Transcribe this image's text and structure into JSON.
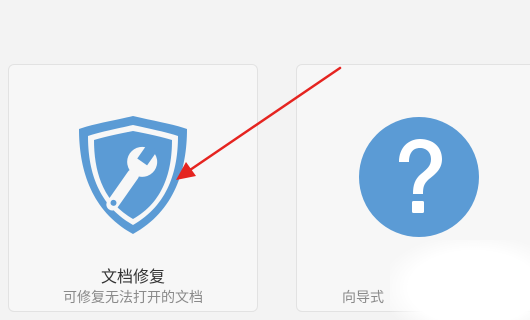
{
  "cards": [
    {
      "title": "文档修复",
      "description": "可修复无法打开的文档",
      "icon": "shield-wrench-icon"
    },
    {
      "title": "",
      "description": "向导式",
      "icon": "question-mark-icon"
    }
  ],
  "colors": {
    "page_background": "#f3f3f3",
    "card_background": "#f7f7f7",
    "icon_blue": "#5b9bd5",
    "annotation_arrow": "#e52420",
    "title_text": "#333333",
    "description_text": "#8a8a8a"
  }
}
